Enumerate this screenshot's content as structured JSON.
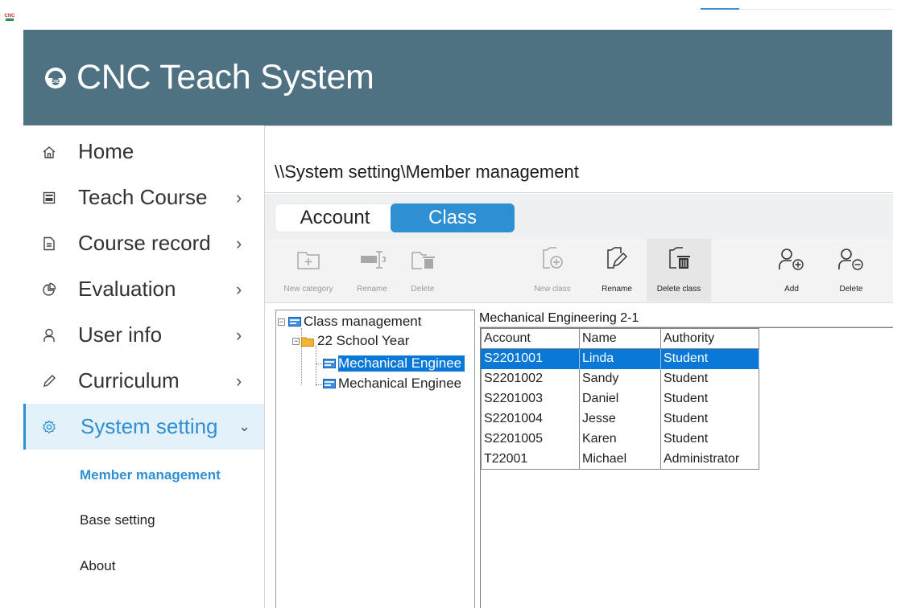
{
  "header": {
    "app_title": "CNC Teach System",
    "logo_text": "CNC",
    "tiny_logo_text": "CNC"
  },
  "sidebar": {
    "items": [
      {
        "label": "Home",
        "icon": "home-icon",
        "has_chevron": false
      },
      {
        "label": "Teach Course",
        "icon": "cnc-course-icon",
        "has_chevron": true
      },
      {
        "label": "Course record",
        "icon": "document-icon",
        "has_chevron": true
      },
      {
        "label": "Evaluation",
        "icon": "pie-chart-icon",
        "has_chevron": true
      },
      {
        "label": "User info",
        "icon": "user-icon",
        "has_chevron": true
      },
      {
        "label": "Curriculum",
        "icon": "pencil-icon",
        "has_chevron": true
      },
      {
        "label": "System setting",
        "icon": "gear-icon",
        "has_chevron": true,
        "expanded": true
      }
    ],
    "sub_items": [
      {
        "label": "Member management",
        "active": true
      },
      {
        "label": "Base setting",
        "active": false
      },
      {
        "label": "About",
        "active": false
      }
    ]
  },
  "content": {
    "breadcrumb": "\\\\System setting\\Member management",
    "tabs": [
      {
        "label": "Account",
        "active": false
      },
      {
        "label": "Class",
        "active": true
      }
    ],
    "toolbar": [
      {
        "label": "New category",
        "icon": "new-category-icon",
        "enabled": false
      },
      {
        "label": "Rename",
        "icon": "rename-category-icon",
        "enabled": false
      },
      {
        "label": "Delete",
        "icon": "delete-category-icon",
        "enabled": false
      },
      {
        "label": "New class",
        "icon": "new-class-icon",
        "enabled": false
      },
      {
        "label": "Rename",
        "icon": "rename-class-icon",
        "enabled": true
      },
      {
        "label": "Delete class",
        "icon": "delete-class-icon",
        "enabled": true
      },
      {
        "label": "Add",
        "icon": "add-user-icon",
        "enabled": true
      },
      {
        "label": "Delete",
        "icon": "remove-user-icon",
        "enabled": true
      }
    ],
    "tree": {
      "root": "Class management",
      "year": "22 School Year",
      "classes": [
        "Mechanical Enginee",
        "Mechanical Enginee"
      ]
    },
    "grid": {
      "title": "Mechanical Engineering 2-1",
      "columns": [
        "Account",
        "Name",
        "Authority"
      ],
      "rows": [
        [
          "S2201001",
          "Linda",
          "Student"
        ],
        [
          "S2201002",
          "Sandy",
          "Student"
        ],
        [
          "S2201003",
          "Daniel",
          "Student"
        ],
        [
          "S2201004",
          "Jesse",
          "Student"
        ],
        [
          "S2201005",
          "Karen",
          "Student"
        ],
        [
          "T22001",
          "Michael",
          "Administrator"
        ]
      ],
      "selected_row": 0
    }
  },
  "colors": {
    "banner": "#4e7281",
    "accent": "#2f8fd3",
    "selection": "#0a78d7"
  }
}
